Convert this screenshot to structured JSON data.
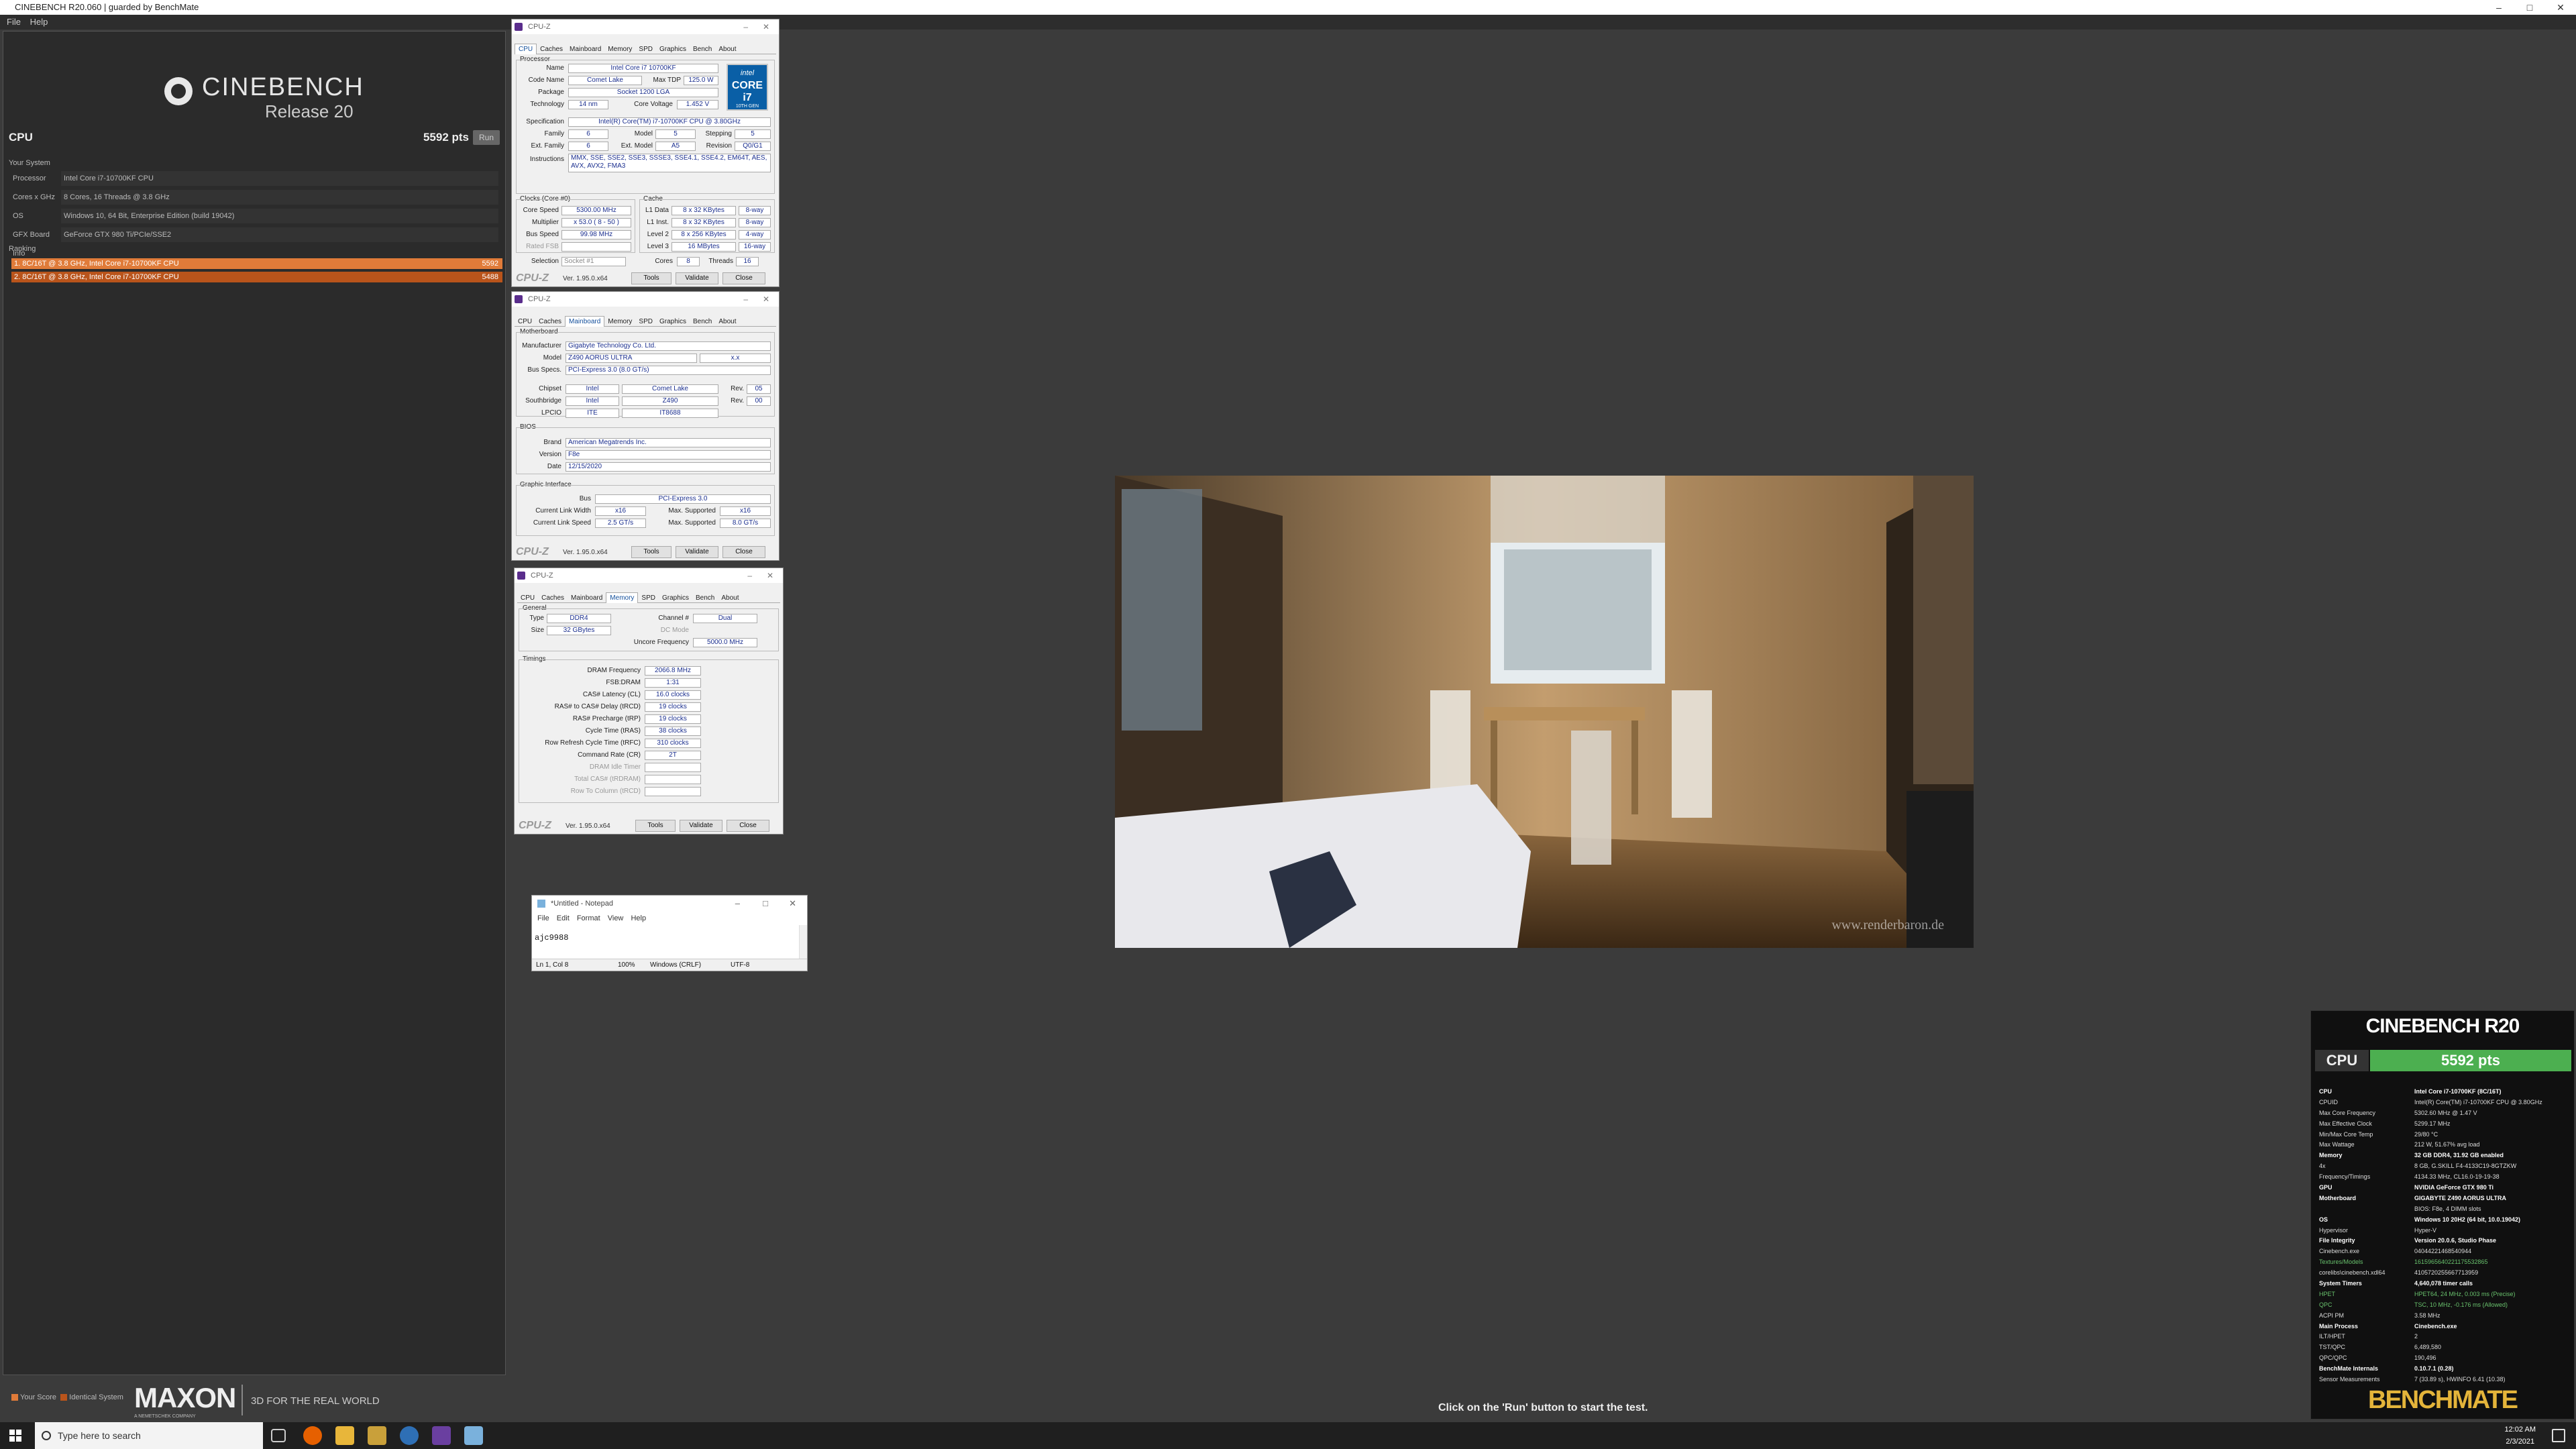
{
  "window": {
    "title": "CINEBENCH R20.060 | guarded by BenchMate"
  },
  "menu": [
    "File",
    "Help"
  ],
  "cinebench": {
    "logo_title": "CINEBENCH",
    "logo_sub": "Release 20",
    "cpu_label": "CPU",
    "cpu_score": "5592 pts",
    "run_label": "Run",
    "your_system": "Your System",
    "system": [
      {
        "k": "Processor",
        "v": "Intel Core i7-10700KF CPU"
      },
      {
        "k": "Cores x GHz",
        "v": "8 Cores, 16 Threads @ 3.8 GHz"
      },
      {
        "k": "OS",
        "v": "Windows 10, 64 Bit, Enterprise Edition (build 19042)"
      },
      {
        "k": "GFX Board",
        "v": "GeForce GTX 980 Ti/PCIe/SSE2"
      },
      {
        "k": "Info",
        "v": ""
      }
    ],
    "ranking_label": "Ranking",
    "ranking": [
      {
        "label": "1. 8C/16T @ 3.8 GHz, Intel Core i7-10700KF CPU",
        "value": "5592",
        "color": "#e07b39"
      },
      {
        "label": "2. 8C/16T @ 3.8 GHz, Intel Core i7-10700KF CPU",
        "value": "5488",
        "color": "#b9541b"
      }
    ],
    "legend_your": "Your Score",
    "legend_identical": "Identical System",
    "maxon": "MAXON",
    "maxon_sub": "A NEMETSCHEK COMPANY",
    "tagline": "3D FOR THE REAL WORLD",
    "hint": "Click on the 'Run' button to start the test."
  },
  "cpuz_common": {
    "title": "CPU-Z",
    "tabs": [
      "CPU",
      "Caches",
      "Mainboard",
      "Memory",
      "SPD",
      "Graphics",
      "Bench",
      "About"
    ],
    "brand": "CPU-Z",
    "version": "Ver. 1.95.0.x64",
    "tools": "Tools",
    "validate": "Validate",
    "close": "Close"
  },
  "cpuz_cpu": {
    "processor": "Processor",
    "name_l": "Name",
    "name": "Intel Core i7 10700KF",
    "code_l": "Code Name",
    "code": "Comet Lake",
    "tdp_l": "Max TDP",
    "tdp": "125.0 W",
    "pkg_l": "Package",
    "pkg": "Socket 1200 LGA",
    "tech_l": "Technology",
    "tech": "14 nm",
    "cv_l": "Core Voltage",
    "cv": "1.452 V",
    "spec_l": "Specification",
    "spec": "Intel(R) Core(TM) i7-10700KF CPU @ 3.80GHz",
    "fam_l": "Family",
    "fam": "6",
    "model_l": "Model",
    "model": "5",
    "step_l": "Stepping",
    "step": "5",
    "efam_l": "Ext. Family",
    "efam": "6",
    "emod_l": "Ext. Model",
    "emod": "A5",
    "rev_l": "Revision",
    "rev": "Q0/G1",
    "inst_l": "Instructions",
    "inst": "MMX, SSE, SSE2, SSE3, SSSE3, SSE4.1, SSE4.2, EM64T, AES, AVX, AVX2, FMA3",
    "clocks": "Clocks (Core #0)",
    "cache": "Cache",
    "cs_l": "Core Speed",
    "cs": "5300.00 MHz",
    "mul_l": "Multiplier",
    "mul": "x 53.0 ( 8 - 50 )",
    "bus_l": "Bus Speed",
    "bus": "99.98 MHz",
    "fsb_l": "Rated FSB",
    "fsb": "",
    "l1d_l": "L1 Data",
    "l1d": "8 x 32 KBytes",
    "l1d_w": "8-way",
    "l1i_l": "L1 Inst.",
    "l1i": "8 x 32 KBytes",
    "l1i_w": "8-way",
    "l2_l": "Level 2",
    "l2": "8 x 256 KBytes",
    "l2_w": "4-way",
    "l3_l": "Level 3",
    "l3": "16 MBytes",
    "l3_w": "16-way",
    "sel_l": "Selection",
    "sel": "Socket #1",
    "cores_l": "Cores",
    "cores": "8",
    "thr_l": "Threads",
    "thr": "16",
    "intel_a": "intel",
    "intel_b": "CORE i7",
    "intel_c": "10TH GEN"
  },
  "cpuz_mb": {
    "motherboard": "Motherboard",
    "man_l": "Manufacturer",
    "man": "Gigabyte Technology Co. Ltd.",
    "model_l": "Model",
    "model": "Z490 AORUS ULTRA",
    "model_rev": "x.x",
    "bus_l": "Bus Specs.",
    "bus": "PCI-Express 3.0 (8.0 GT/s)",
    "chip_l": "Chipset",
    "chip_a": "Intel",
    "chip_b": "Comet Lake",
    "chip_rev_l": "Rev.",
    "chip_rev": "05",
    "sb_l": "Southbridge",
    "sb_a": "Intel",
    "sb_b": "Z490",
    "sb_rev_l": "Rev.",
    "sb_rev": "00",
    "lpc_l": "LPCIO",
    "lpc_a": "ITE",
    "lpc_b": "IT8688",
    "bios": "BIOS",
    "brand_l": "Brand",
    "brand": "American Megatrends Inc.",
    "ver_l": "Version",
    "ver": "F8e",
    "date_l": "Date",
    "date": "12/15/2020",
    "gi": "Graphic Interface",
    "gbus_l": "Bus",
    "gbus": "PCI-Express 3.0",
    "clw_l": "Current Link Width",
    "clw": "x16",
    "mlw_l": "Max. Supported",
    "mlw": "x16",
    "cls_l": "Current Link Speed",
    "cls": "2.5 GT/s",
    "mls_l": "Max. Supported",
    "mls": "8.0 GT/s"
  },
  "cpuz_mem": {
    "general": "General",
    "type_l": "Type",
    "type": "DDR4",
    "ch_l": "Channel #",
    "ch": "Dual",
    "size_l": "Size",
    "size": "32 GBytes",
    "dc_l": "DC Mode",
    "dc": "",
    "unc_l": "Uncore Frequency",
    "unc": "5000.0 MHz",
    "timings": "Timings",
    "rows": [
      {
        "k": "DRAM Frequency",
        "v": "2066.8 MHz"
      },
      {
        "k": "FSB:DRAM",
        "v": "1:31"
      },
      {
        "k": "CAS# Latency (CL)",
        "v": "16.0 clocks"
      },
      {
        "k": "RAS# to CAS# Delay (tRCD)",
        "v": "19 clocks"
      },
      {
        "k": "RAS# Precharge (tRP)",
        "v": "19 clocks"
      },
      {
        "k": "Cycle Time (tRAS)",
        "v": "38 clocks"
      },
      {
        "k": "Row Refresh Cycle Time (tRFC)",
        "v": "310 clocks"
      },
      {
        "k": "Command Rate (CR)",
        "v": "2T"
      },
      {
        "k": "DRAM Idle Timer",
        "v": ""
      },
      {
        "k": "Total CAS# (tRDRAM)",
        "v": ""
      },
      {
        "k": "Row To Column (tRCD)",
        "v": ""
      }
    ]
  },
  "notepad": {
    "title": "*Untitled - Notepad",
    "menu": [
      "File",
      "Edit",
      "Format",
      "View",
      "Help"
    ],
    "text": "ajc9988",
    "pos": "Ln 1, Col 8",
    "zoom": "100%",
    "eol": "Windows (CRLF)",
    "enc": "UTF-8"
  },
  "render": {
    "watermark": "www.renderbaron.de"
  },
  "benchmate": {
    "title": "CINEBENCH R20",
    "cpu_label": "CPU",
    "cpu_score": "5592 pts",
    "rows": [
      {
        "k": "CPU",
        "v": "Intel Core i7-10700KF (8C/16T)",
        "s": "b"
      },
      {
        "k": "CPUID",
        "v": "Intel(R) Core(TM) i7-10700KF CPU @ 3.80GHz",
        "s": ""
      },
      {
        "k": "Max Core Frequency",
        "v": "5302.60 MHz @ 1.47 V",
        "s": ""
      },
      {
        "k": "Max Effective Clock",
        "v": "5299.17 MHz",
        "s": ""
      },
      {
        "k": "Min/Max Core Temp",
        "v": "29/80 °C",
        "s": ""
      },
      {
        "k": "Max Wattage",
        "v": "212 W, 51.67% avg load",
        "s": ""
      },
      {
        "k": "Memory",
        "v": "32 GB DDR4, 31.92 GB enabled",
        "s": "b"
      },
      {
        "k": "4x",
        "v": "8 GB, G.SKILL F4-4133C19-8GTZKW",
        "s": ""
      },
      {
        "k": "Frequency/Timings",
        "v": "4134.33 MHz, CL16.0-19-19-38",
        "s": ""
      },
      {
        "k": "GPU",
        "v": "NVIDIA GeForce GTX 980 Ti",
        "s": "b"
      },
      {
        "k": "Motherboard",
        "v": "GIGABYTE Z490 AORUS ULTRA",
        "s": "b"
      },
      {
        "k": "",
        "v": "BIOS: F8e, 4 DIMM slots",
        "s": ""
      },
      {
        "k": "OS",
        "v": "Windows 10 20H2 (64 bit, 10.0.19042)",
        "s": "b"
      },
      {
        "k": "Hypervisor",
        "v": "Hyper-V",
        "s": ""
      },
      {
        "k": "File Integrity",
        "v": "Version 20.0.6, Studio Phase",
        "s": "b"
      },
      {
        "k": "Cinebench.exe",
        "v": "04044221468540944",
        "s": ""
      },
      {
        "k": "Textures/Models",
        "v": "1615965640221175532865",
        "s": "g"
      },
      {
        "k": "corelibs\\cinebench.xdl64",
        "v": "4105720255667713959",
        "s": ""
      },
      {
        "k": "System Timers",
        "v": "4,640,078 timer calls",
        "s": "b"
      },
      {
        "k": "HPET",
        "v": "HPET64, 24 MHz, 0.003 ms (Precise)",
        "s": "g"
      },
      {
        "k": "QPC",
        "v": "TSC, 10 MHz, -0.176 ms (Allowed)",
        "s": "g"
      },
      {
        "k": "ACPI PM",
        "v": "3.58 MHz",
        "s": ""
      },
      {
        "k": "Main Process",
        "v": "Cinebench.exe",
        "s": "b"
      },
      {
        "k": "ILT/HPET",
        "v": "2",
        "s": ""
      },
      {
        "k": "TST/QPC",
        "v": "6,489,580",
        "s": ""
      },
      {
        "k": "QPC/QPC",
        "v": "190,496",
        "s": ""
      },
      {
        "k": "BenchMate Internals",
        "v": "0.10.7.1 (0.28)",
        "s": "b"
      },
      {
        "k": "Sensor Measurements",
        "v": "7 (33.89 s), HWINFO 6.41 (10.38)",
        "s": ""
      }
    ],
    "logo": "BENCHMATE"
  },
  "taskbar": {
    "search": "Type here to search",
    "time": "12:02 AM",
    "date": "2/3/2021"
  }
}
